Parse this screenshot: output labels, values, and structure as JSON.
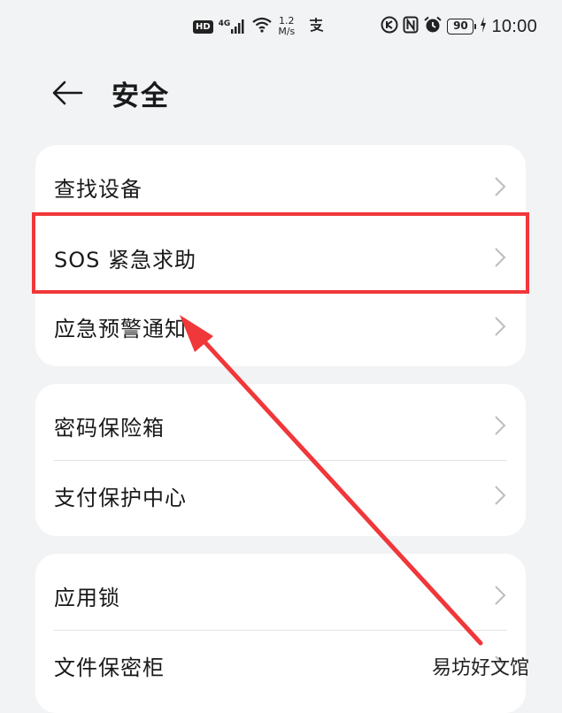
{
  "status_bar": {
    "hd": "HD",
    "network": "4G",
    "speed_value": "1.2",
    "speed_unit": "M/s",
    "battery": "90",
    "time": "10:00"
  },
  "header": {
    "title": "安全"
  },
  "groups": [
    {
      "items": [
        {
          "label": "查找设备"
        },
        {
          "label": "SOS 紧急求助"
        },
        {
          "label": "应急预警通知"
        }
      ]
    },
    {
      "items": [
        {
          "label": "密码保险箱"
        },
        {
          "label": "支付保护中心"
        }
      ]
    },
    {
      "items": [
        {
          "label": "应用锁"
        },
        {
          "label": "文件保密柜"
        }
      ]
    }
  ],
  "watermark": "易坊好文馆",
  "colors": {
    "annotation": "#f0373a",
    "background": "#f1f3f5",
    "card": "#ffffff"
  }
}
